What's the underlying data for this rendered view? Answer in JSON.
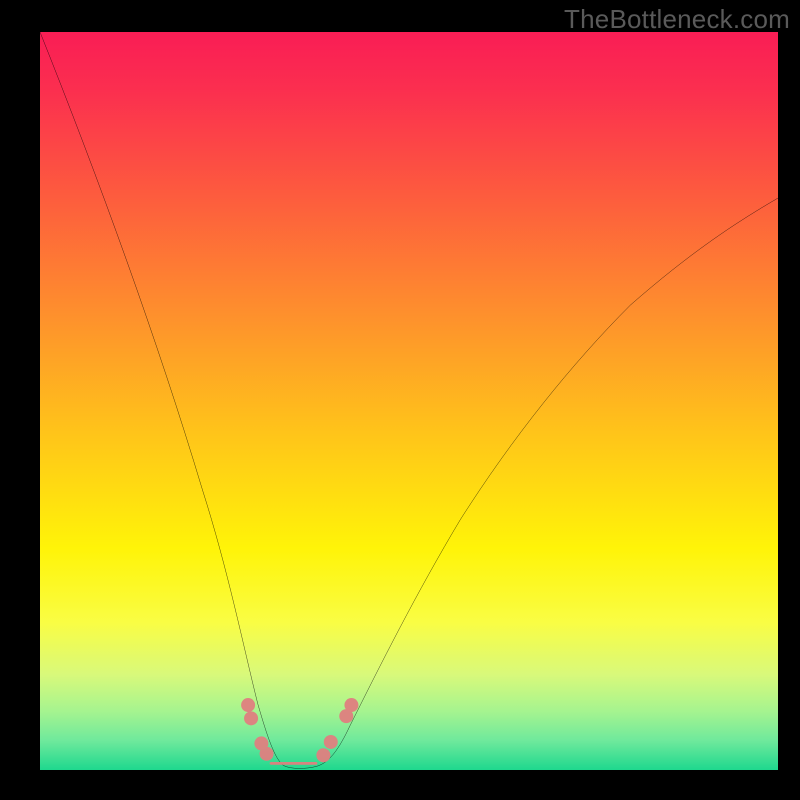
{
  "watermark": "TheBottleneck.com",
  "chart_data": {
    "type": "line",
    "title": "",
    "xlabel": "",
    "ylabel": "",
    "xlim": [
      0,
      100
    ],
    "ylim": [
      0,
      100
    ],
    "x": [
      0,
      5,
      10,
      15,
      20,
      25,
      28,
      30,
      32,
      34,
      36,
      38,
      40,
      45,
      50,
      55,
      60,
      65,
      70,
      75,
      80,
      85,
      90,
      95,
      100
    ],
    "values": [
      100,
      85,
      70,
      55,
      40,
      24,
      14,
      6,
      2,
      0,
      0,
      0,
      2,
      10,
      20,
      30,
      38,
      46,
      53,
      59,
      64,
      69,
      73,
      76,
      78
    ],
    "gradient_colors_top_to_bottom": [
      "#f91d55",
      "#fd5b3e",
      "#ffc31a",
      "#fff408",
      "#1ed88e"
    ],
    "floor_markers": {
      "color": "#e28585",
      "segments": [
        {
          "x_start": 28,
          "x_end": 39,
          "style": "dotted-wide"
        },
        {
          "x_start": 31,
          "x_end": 37,
          "style": "solid-thick"
        }
      ]
    }
  }
}
